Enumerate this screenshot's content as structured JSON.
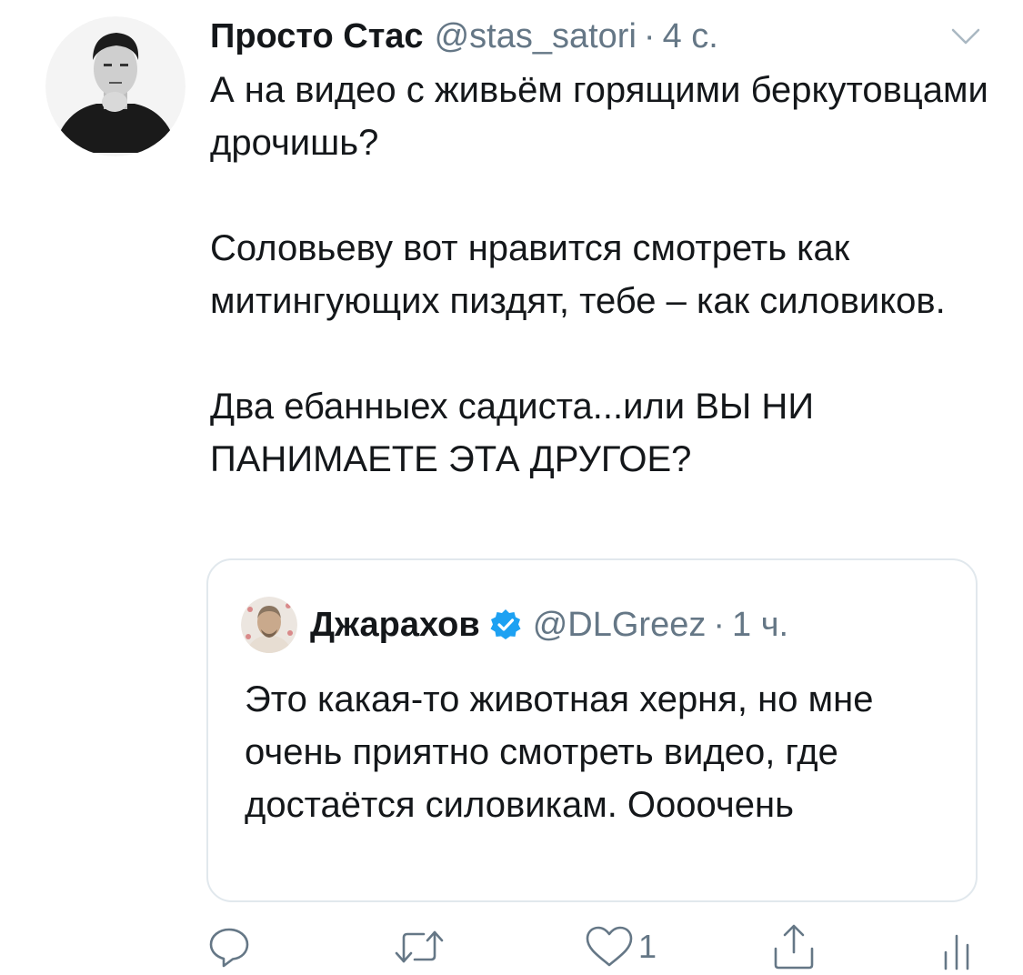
{
  "tweet": {
    "display_name": "Просто Стас",
    "handle": "@stas_satori",
    "separator": "·",
    "time": "4 с.",
    "paragraphs": [
      "А на видео с живьём горящими беркутовцами дрочишь?",
      "Соловьеву вот нравится смотреть как митингующих пиздят, тебе – как силовиков.",
      "Два ебанныех садиста...или ВЫ НИ ПАНИМАЕТЕ ЭТА ДРУГОЕ?"
    ]
  },
  "quoted_tweet": {
    "display_name": "Джарахов",
    "handle": "@DLGreez",
    "separator": "·",
    "time": "1 ч.",
    "text": "Это какая-то животная херня, но мне очень приятно смотреть видео, где достаётся силовикам. Оооочень"
  },
  "actions": {
    "reply_icon": "reply-icon",
    "retweet_icon": "retweet-icon",
    "like_icon": "heart-icon",
    "like_count": "1",
    "share_icon": "share-icon",
    "analytics_icon": "analytics-icon"
  },
  "colors": {
    "text": "#14171a",
    "secondary": "#657786",
    "border": "#e1e8ed",
    "verified": "#1da1f2"
  }
}
